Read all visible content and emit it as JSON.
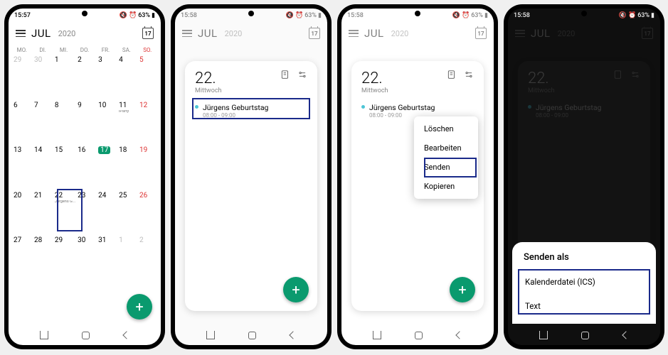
{
  "status": {
    "time1": "15:57",
    "time2": "15:58",
    "battery": "63%"
  },
  "header": {
    "month": "JUL",
    "year": "2020",
    "today_day": "17"
  },
  "weekdays": [
    "MO.",
    "DI.",
    "MI.",
    "DO.",
    "FR.",
    "SA.",
    "SO."
  ],
  "grid": {
    "rows": [
      [
        "29",
        "30",
        "1",
        "2",
        "3",
        "4",
        "5"
      ],
      [
        "6",
        "7",
        "8",
        "9",
        "10",
        "11",
        "12"
      ],
      [
        "13",
        "14",
        "15",
        "16",
        "17",
        "18",
        "19"
      ],
      [
        "20",
        "21",
        "22",
        "23",
        "24",
        "25",
        "26"
      ],
      [
        "27",
        "28",
        "29",
        "30",
        "31",
        "1",
        "2"
      ]
    ],
    "events": {
      "11": "iParty",
      "22": "Jürgens G..."
    }
  },
  "day": {
    "num": "22.",
    "name": "Mittwoch",
    "event_title": "Jürgens Geburtstag",
    "event_time": "08:00 - 09:00"
  },
  "context_menu": {
    "delete": "Löschen",
    "edit": "Bearbeiten",
    "send": "Senden",
    "copy": "Kopieren"
  },
  "sheet": {
    "title": "Senden als",
    "opt_ics": "Kalenderdatei (ICS)",
    "opt_text": "Text"
  }
}
